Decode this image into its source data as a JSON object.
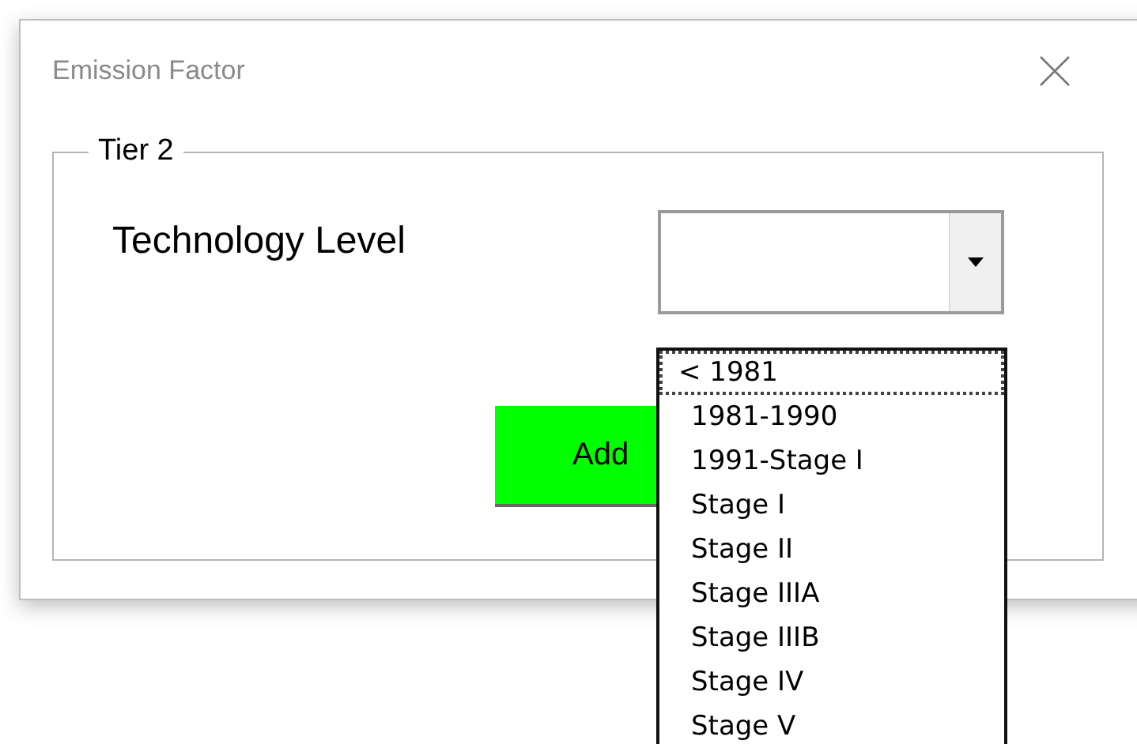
{
  "window": {
    "title": "Emission Factor"
  },
  "group": {
    "title": "Tier 2"
  },
  "technology_level": {
    "label": "Technology Level"
  },
  "add_button": {
    "label": "Add"
  },
  "dropdown": {
    "open": true,
    "items": [
      {
        "label": "< 1981",
        "selected": true
      },
      {
        "label": "1981-1990",
        "selected": false
      },
      {
        "label": "1991-Stage I",
        "selected": false
      },
      {
        "label": "Stage I",
        "selected": false
      },
      {
        "label": "Stage II",
        "selected": false
      },
      {
        "label": "Stage IIIA",
        "selected": false
      },
      {
        "label": "Stage IIIB",
        "selected": false
      },
      {
        "label": "Stage IV",
        "selected": false
      },
      {
        "label": "Stage V",
        "selected": false
      }
    ]
  }
}
